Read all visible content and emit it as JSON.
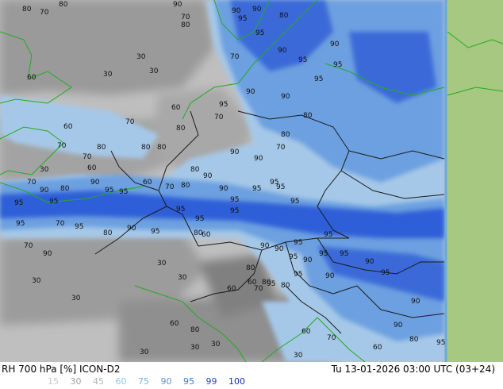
{
  "header": {
    "left_title": "RH 700 hPa [%] ICON-D2",
    "right_title": "Tu 13-01-2026 03:00 UTC (03+24)"
  },
  "legend": {
    "values": [
      "15",
      "30",
      "45",
      "60",
      "75",
      "90",
      "95",
      "99",
      "100"
    ],
    "colors": [
      "#c8c8c8",
      "#a0a0a0",
      "#aab4be",
      "#8cc8e6",
      "#78b4e6",
      "#5a96dc",
      "#3c78d2",
      "#1e50c8",
      "#1430aa"
    ]
  },
  "map": {
    "colors": {
      "low": "#c0c0c0",
      "mid": "#999999",
      "dark": "#808080",
      "moist": "#a6c8e8",
      "wet": "#6da0e0",
      "saturated": "#2f5fd8",
      "outside": "#a6c880",
      "border": "#1a1a1a",
      "coast": "#22aa22"
    },
    "labels": [
      {
        "t": "80"
      },
      {
        "t": "80"
      },
      {
        "t": "70"
      },
      {
        "t": "90"
      },
      {
        "t": "70"
      },
      {
        "t": "80"
      },
      {
        "t": "90"
      },
      {
        "t": "95"
      },
      {
        "t": "90"
      },
      {
        "t": "80"
      },
      {
        "t": "30"
      },
      {
        "t": "30"
      },
      {
        "t": "30"
      },
      {
        "t": "60"
      },
      {
        "t": "70"
      },
      {
        "t": "95"
      },
      {
        "t": "90"
      },
      {
        "t": "95"
      },
      {
        "t": "90"
      },
      {
        "t": "95"
      },
      {
        "t": "60"
      },
      {
        "t": "70"
      },
      {
        "t": "80"
      },
      {
        "t": "95"
      },
      {
        "t": "90"
      },
      {
        "t": "90"
      },
      {
        "t": "80"
      },
      {
        "t": "95"
      },
      {
        "t": "60"
      },
      {
        "t": "70"
      },
      {
        "t": "80"
      },
      {
        "t": "70"
      },
      {
        "t": "80"
      },
      {
        "t": "80"
      },
      {
        "t": "70"
      },
      {
        "t": "90"
      },
      {
        "t": "90"
      },
      {
        "t": "95"
      },
      {
        "t": "80"
      },
      {
        "t": "70"
      },
      {
        "t": "60"
      },
      {
        "t": "60"
      },
      {
        "t": "70"
      },
      {
        "t": "80"
      },
      {
        "t": "80"
      },
      {
        "t": "90"
      },
      {
        "t": "30"
      },
      {
        "t": "70"
      },
      {
        "t": "80"
      },
      {
        "t": "90"
      },
      {
        "t": "95"
      },
      {
        "t": "95"
      },
      {
        "t": "90"
      },
      {
        "t": "95"
      },
      {
        "t": "95"
      },
      {
        "t": "95"
      },
      {
        "t": "90"
      },
      {
        "t": "95"
      },
      {
        "t": "95"
      },
      {
        "t": "95"
      },
      {
        "t": "95"
      },
      {
        "t": "95"
      },
      {
        "t": "95"
      },
      {
        "t": "95"
      },
      {
        "t": "70"
      },
      {
        "t": "95"
      },
      {
        "t": "90"
      },
      {
        "t": "80"
      },
      {
        "t": "95"
      },
      {
        "t": "60"
      },
      {
        "t": "80"
      },
      {
        "t": "90"
      },
      {
        "t": "90"
      },
      {
        "t": "95"
      },
      {
        "t": "95"
      },
      {
        "t": "95"
      },
      {
        "t": "30"
      },
      {
        "t": "30"
      },
      {
        "t": "70"
      },
      {
        "t": "90"
      },
      {
        "t": "80"
      },
      {
        "t": "95"
      },
      {
        "t": "95"
      },
      {
        "t": "90"
      },
      {
        "t": "95"
      },
      {
        "t": "90"
      },
      {
        "t": "30"
      },
      {
        "t": "60"
      },
      {
        "t": "80"
      },
      {
        "t": "95"
      },
      {
        "t": "90"
      },
      {
        "t": "95"
      },
      {
        "t": "60"
      },
      {
        "t": "70"
      },
      {
        "t": "80"
      },
      {
        "t": "90"
      },
      {
        "t": "30"
      },
      {
        "t": "30"
      },
      {
        "t": "30"
      },
      {
        "t": "30"
      },
      {
        "t": "60"
      },
      {
        "t": "70"
      },
      {
        "t": "60"
      },
      {
        "t": "80"
      },
      {
        "t": "95"
      },
      {
        "t": "90"
      },
      {
        "t": "60"
      },
      {
        "t": "80"
      },
      {
        "t": "30"
      }
    ]
  }
}
